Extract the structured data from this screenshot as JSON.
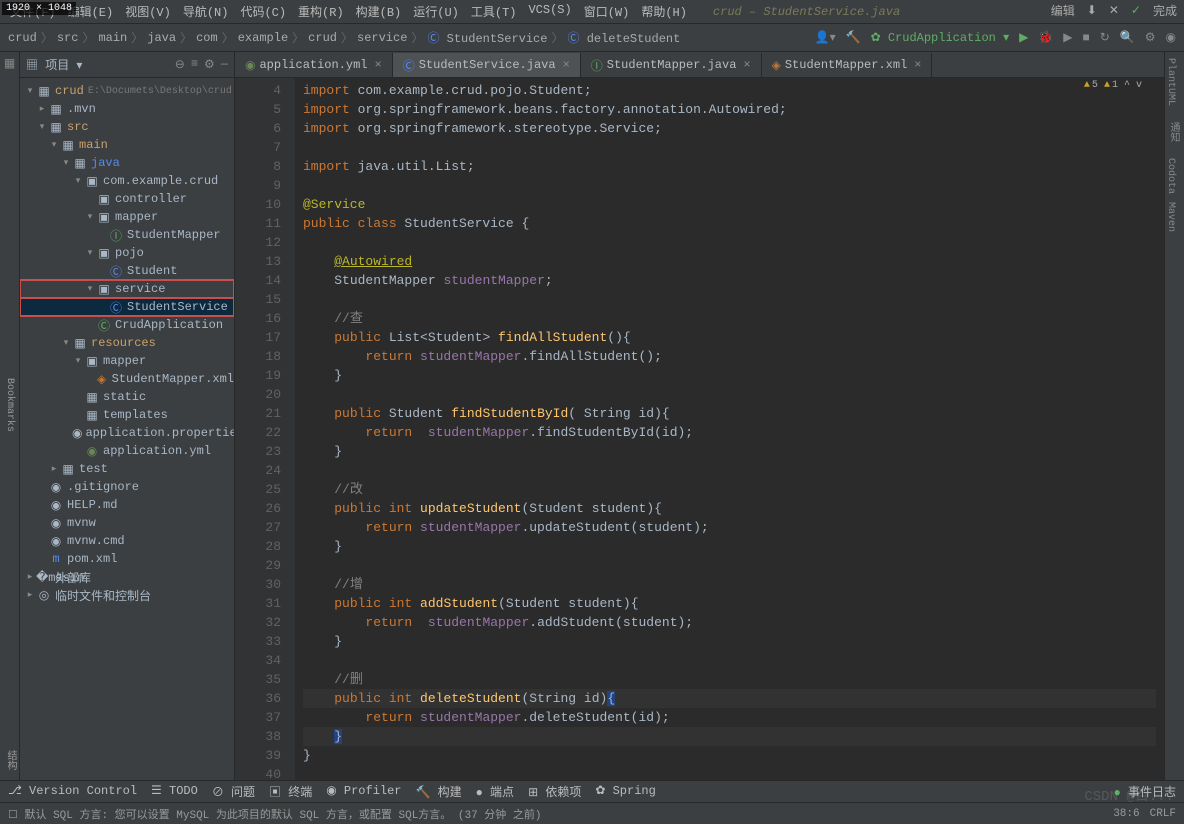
{
  "dim_badge": "1920 × 1048",
  "menus": [
    "文件(F)",
    "编辑(E)",
    "视图(V)",
    "导航(N)",
    "代码(C)",
    "重构(R)",
    "构建(B)",
    "运行(U)",
    "工具(T)",
    "VCS(S)",
    "窗口(W)",
    "帮助(H)"
  ],
  "tab_title": "crud – StudentService.java",
  "top_right": {
    "edit": "编辑",
    "done": "完成"
  },
  "breadcrumbs": [
    "crud",
    "src",
    "main",
    "java",
    "com",
    "example",
    "crud",
    "service",
    "StudentService",
    "deleteStudent"
  ],
  "run_config": "CrudApplication",
  "project_label": "项目",
  "tree": [
    {
      "d": 0,
      "a": "▾",
      "i": "▦",
      "t": "crud",
      "ex": "E:\\Documets\\Desktop\\crud",
      "cls": "dir"
    },
    {
      "d": 1,
      "a": "▸",
      "i": "▦",
      "t": ".mvn"
    },
    {
      "d": 1,
      "a": "▾",
      "i": "▦",
      "t": "src",
      "cls": "dir"
    },
    {
      "d": 2,
      "a": "▾",
      "i": "▦",
      "t": "main",
      "cls": "dir"
    },
    {
      "d": 3,
      "a": "▾",
      "i": "▦",
      "t": "java",
      "cls": "dir ico-c"
    },
    {
      "d": 4,
      "a": "▾",
      "i": "▣",
      "t": "com.example.crud"
    },
    {
      "d": 5,
      "a": "",
      "i": "▣",
      "t": "controller"
    },
    {
      "d": 5,
      "a": "▾",
      "i": "▣",
      "t": "mapper"
    },
    {
      "d": 6,
      "a": "",
      "i": "Ⓘ",
      "t": "StudentMapper",
      "ic": "ico-g"
    },
    {
      "d": 5,
      "a": "▾",
      "i": "▣",
      "t": "pojo"
    },
    {
      "d": 6,
      "a": "",
      "i": "Ⓒ",
      "t": "Student",
      "ic": "ico-c"
    },
    {
      "d": 5,
      "a": "▾",
      "i": "▣",
      "t": "service",
      "box": true
    },
    {
      "d": 6,
      "a": "",
      "i": "Ⓒ",
      "t": "StudentService",
      "ic": "ico-c",
      "sel": true,
      "box": true
    },
    {
      "d": 5,
      "a": "",
      "i": "Ⓒ",
      "t": "CrudApplication",
      "ic": "ico-g"
    },
    {
      "d": 3,
      "a": "▾",
      "i": "▦",
      "t": "resources",
      "cls": "dir"
    },
    {
      "d": 4,
      "a": "▾",
      "i": "▣",
      "t": "mapper"
    },
    {
      "d": 5,
      "a": "",
      "i": "◈",
      "t": "StudentMapper.xml",
      "ic": "ico-x"
    },
    {
      "d": 4,
      "a": "",
      "i": "▦",
      "t": "static"
    },
    {
      "d": 4,
      "a": "",
      "i": "▦",
      "t": "templates"
    },
    {
      "d": 4,
      "a": "",
      "i": "◉",
      "t": "application.properties"
    },
    {
      "d": 4,
      "a": "",
      "i": "◉",
      "t": "application.yml",
      "ic": "ico-y"
    },
    {
      "d": 2,
      "a": "▸",
      "i": "▦",
      "t": "test"
    },
    {
      "d": 1,
      "a": "",
      "i": "◉",
      "t": ".gitignore"
    },
    {
      "d": 1,
      "a": "",
      "i": "◉",
      "t": "HELP.md"
    },
    {
      "d": 1,
      "a": "",
      "i": "◉",
      "t": "mvnw"
    },
    {
      "d": 1,
      "a": "",
      "i": "◉",
      "t": "mvnw.cmd"
    },
    {
      "d": 1,
      "a": "",
      "i": "m",
      "t": "pom.xml",
      "ic": "ico-c"
    },
    {
      "d": 0,
      "a": "▸",
      "i": "�masın",
      "t": "外部库"
    },
    {
      "d": 0,
      "a": "▸",
      "i": "◎",
      "t": "临时文件和控制台"
    }
  ],
  "editor_tabs": [
    {
      "icon": "◉",
      "label": "application.yml",
      "cls": "ico-y"
    },
    {
      "icon": "Ⓒ",
      "label": "StudentService.java",
      "cls": "ico-c",
      "active": true
    },
    {
      "icon": "Ⓘ",
      "label": "StudentMapper.java",
      "cls": "ico-g"
    },
    {
      "icon": "◈",
      "label": "StudentMapper.xml",
      "cls": "ico-x"
    }
  ],
  "err": {
    "warn1": "5",
    "warn2": "1",
    "up": "^",
    "down": "v"
  },
  "code": [
    {
      "n": 4,
      "h": "<span class='kw'>import </span>com.example.crud.pojo.Student;"
    },
    {
      "n": 5,
      "h": "<span class='kw'>import </span>org.springframework.beans.factory.annotation.<span class='type'>Autowired</span>;"
    },
    {
      "n": 6,
      "h": "<span class='kw'>import </span>org.springframework.stereotype.<span class='type'>Service</span>;"
    },
    {
      "n": 7,
      "h": ""
    },
    {
      "n": 8,
      "h": "<span class='kw'>import </span>java.util.List;"
    },
    {
      "n": 9,
      "h": ""
    },
    {
      "n": 10,
      "h": "<span class='anno'>@Service</span>"
    },
    {
      "n": 11,
      "h": "<span class='kw'>public class </span><span class='type'>StudentService</span> {",
      "icon": "⬤"
    },
    {
      "n": 12,
      "h": ""
    },
    {
      "n": 13,
      "h": "    <span class='anno-u'>@Autowired</span>"
    },
    {
      "n": 14,
      "h": "    <span class='type'>StudentMapper</span> <span class='field'>studentMapper</span>;",
      "icon": "⬤⬤"
    },
    {
      "n": 15,
      "h": ""
    },
    {
      "n": 16,
      "h": "    <span class='comm'>//查</span>"
    },
    {
      "n": 17,
      "h": "    <span class='kw'>public </span>List&lt;Student&gt; <span class='fn'>findAllStudent</span>(){"
    },
    {
      "n": 18,
      "h": "        <span class='kw'>return </span><span class='field'>studentMapper</span>.findAllStudent();"
    },
    {
      "n": 19,
      "h": "    }"
    },
    {
      "n": 20,
      "h": ""
    },
    {
      "n": 21,
      "h": "    <span class='kw'>public </span>Student <span class='fn'>findStudentById</span>( String <span class='param'>id</span>){"
    },
    {
      "n": 22,
      "h": "        <span class='kw'>return  </span><span class='field'>studentMapper</span>.findStudentById(<span class='param'>id</span>);"
    },
    {
      "n": 23,
      "h": "    }"
    },
    {
      "n": 24,
      "h": ""
    },
    {
      "n": 25,
      "h": "    <span class='comm'>//改</span>"
    },
    {
      "n": 26,
      "h": "    <span class='kw'>public int </span><span class='fn'>updateStudent</span>(<span class='type'>Student</span> <span class='param'>student</span>){"
    },
    {
      "n": 27,
      "h": "        <span class='kw'>return </span><span class='field'>studentMapper</span>.updateStudent(<span class='param'>student</span>);"
    },
    {
      "n": 28,
      "h": "    }"
    },
    {
      "n": 29,
      "h": ""
    },
    {
      "n": 30,
      "h": "    <span class='comm'>//增</span>"
    },
    {
      "n": 31,
      "h": "    <span class='kw'>public int </span><span class='fn'>addStudent</span>(<span class='type'>Student</span> <span class='param'>student</span>){"
    },
    {
      "n": 32,
      "h": "        <span class='kw'>return  </span><span class='field'>studentMapper</span>.addStudent(<span class='param'>student</span>);"
    },
    {
      "n": 33,
      "h": "    }"
    },
    {
      "n": 34,
      "h": ""
    },
    {
      "n": 35,
      "h": "    <span class='comm'>//删</span>"
    },
    {
      "n": 36,
      "h": "    <span class='kw'>public int </span><span class='fn'>deleteStudent</span>(<span class='type'>String</span> <span class='param'>id</span>)<span style='background:#214283'>{</span>",
      "hl": true
    },
    {
      "n": 37,
      "h": "        <span class='kw'>return </span><span class='field'>studentMapper</span>.deleteStudent(<span class='param'>id</span>);"
    },
    {
      "n": 38,
      "h": "    <span style='background:#214283'>}</span>",
      "hl": true
    },
    {
      "n": 39,
      "h": "}"
    },
    {
      "n": 40,
      "h": ""
    }
  ],
  "bottom_tools": [
    "Version Control",
    "TODO",
    "问题",
    "终端",
    "Profiler",
    "构建",
    "端点",
    "依赖项",
    "Spring"
  ],
  "bottom_right": "事件日志",
  "status_msg": "默认 SQL 方言: 您可以设置 MySQL 为此项目的默认 SQL 方言，或配置 SQL方言。 (37 分钟 之前)",
  "status_right": {
    "pos": "38:6",
    "enc": "CRLF"
  },
  "watermark": "CSDN @百..."
}
